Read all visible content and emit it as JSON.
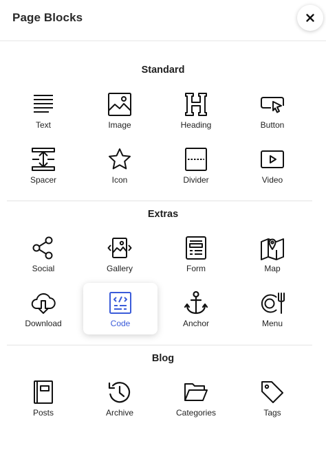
{
  "header": {
    "title": "Page Blocks",
    "close_icon": "close-icon"
  },
  "accent_color": "#3a5bd9",
  "sections": [
    {
      "title": "Standard",
      "items": [
        {
          "label": "Text",
          "icon": "text-icon"
        },
        {
          "label": "Image",
          "icon": "image-icon"
        },
        {
          "label": "Heading",
          "icon": "heading-icon"
        },
        {
          "label": "Button",
          "icon": "button-icon"
        },
        {
          "label": "Spacer",
          "icon": "spacer-icon"
        },
        {
          "label": "Icon",
          "icon": "star-icon"
        },
        {
          "label": "Divider",
          "icon": "divider-icon"
        },
        {
          "label": "Video",
          "icon": "video-icon"
        }
      ]
    },
    {
      "title": "Extras",
      "items": [
        {
          "label": "Social",
          "icon": "share-icon"
        },
        {
          "label": "Gallery",
          "icon": "gallery-icon"
        },
        {
          "label": "Form",
          "icon": "form-icon"
        },
        {
          "label": "Map",
          "icon": "map-icon"
        },
        {
          "label": "Download",
          "icon": "cloud-download-icon"
        },
        {
          "label": "Code",
          "icon": "code-icon",
          "selected": true
        },
        {
          "label": "Anchor",
          "icon": "anchor-icon"
        },
        {
          "label": "Menu",
          "icon": "menu-icon"
        }
      ]
    },
    {
      "title": "Blog",
      "items": [
        {
          "label": "Posts",
          "icon": "book-icon"
        },
        {
          "label": "Archive",
          "icon": "history-icon"
        },
        {
          "label": "Categories",
          "icon": "folder-icon"
        },
        {
          "label": "Tags",
          "icon": "tag-icon"
        }
      ]
    }
  ]
}
